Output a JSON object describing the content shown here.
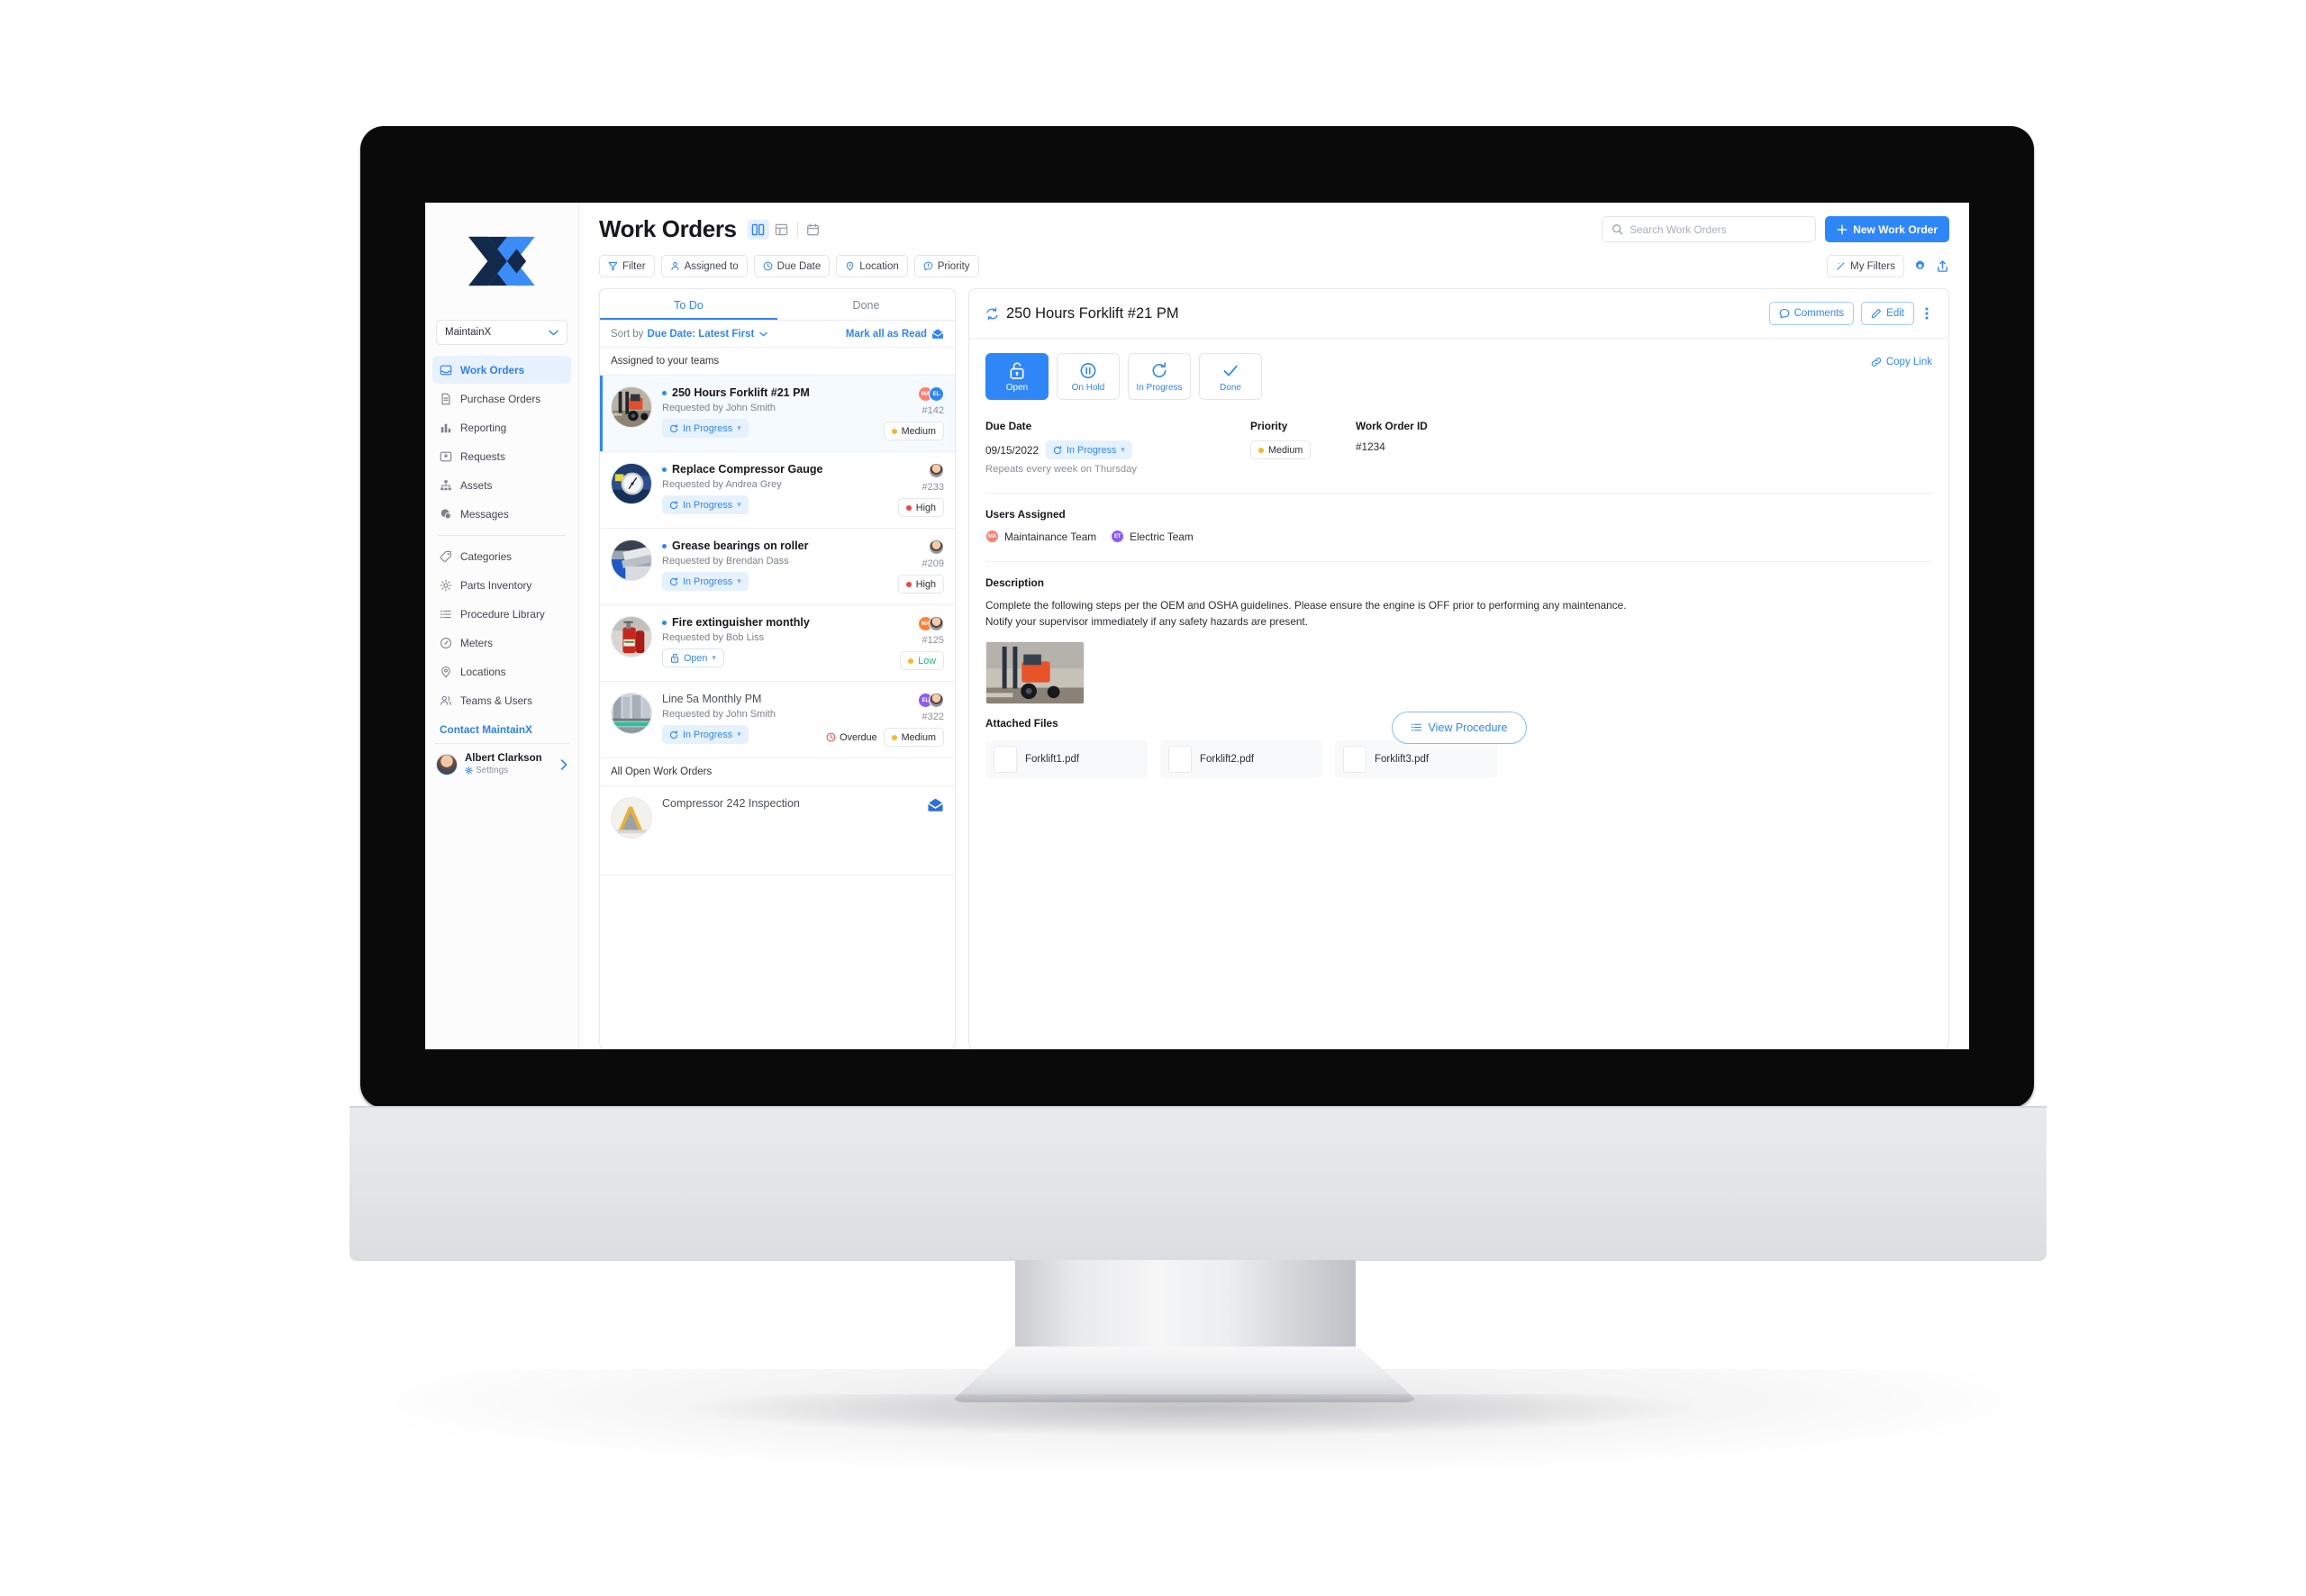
{
  "sidebar": {
    "logo_name": "maintainx-logo",
    "org": {
      "label": "MaintainX"
    },
    "items": [
      {
        "label": "Work Orders",
        "icon": "inbox-icon",
        "active": true
      },
      {
        "label": "Purchase Orders",
        "icon": "document-icon",
        "active": false
      },
      {
        "label": "Reporting",
        "icon": "bar-chart-icon",
        "active": false
      },
      {
        "label": "Requests",
        "icon": "inbox-down-icon",
        "active": false
      },
      {
        "label": "Assets",
        "icon": "hierarchy-icon",
        "active": false
      },
      {
        "label": "Messages",
        "icon": "chat-bubble-icon",
        "active": false
      }
    ],
    "items2": [
      {
        "label": "Categories",
        "icon": "tag-icon"
      },
      {
        "label": "Parts Inventory",
        "icon": "gear-icon"
      },
      {
        "label": "Procedure Library",
        "icon": "list-icon"
      },
      {
        "label": "Meters",
        "icon": "gauge-icon"
      },
      {
        "label": "Locations",
        "icon": "map-pin-icon"
      },
      {
        "label": "Teams & Users",
        "icon": "people-icon"
      }
    ],
    "contact": "Contact MaintainX",
    "user": {
      "name": "Albert Clarkson",
      "settings": "Settings"
    }
  },
  "header": {
    "title": "Work Orders",
    "views": [
      {
        "name": "split-view",
        "active": true
      },
      {
        "name": "table-view",
        "active": false
      },
      {
        "name": "calendar-view",
        "active": false
      }
    ],
    "search": {
      "placeholder": "Search Work Orders",
      "value": ""
    },
    "new_work_order": "New Work Order"
  },
  "filters": {
    "chips": [
      {
        "label": "Filter",
        "icon": "funnel-icon"
      },
      {
        "label": "Assigned to",
        "icon": "person-icon"
      },
      {
        "label": "Due Date",
        "icon": "clock-icon"
      },
      {
        "label": "Location",
        "icon": "map-pin-icon"
      },
      {
        "label": "Priority",
        "icon": "exclamation-bubble-icon"
      }
    ],
    "my_filters": "My Filters",
    "settings_icon": "gear-icon",
    "export_icon": "share-upload-icon"
  },
  "list": {
    "tabs": [
      {
        "label": "To Do",
        "active": true
      },
      {
        "label": "Done",
        "active": false
      }
    ],
    "sort_label": "Sort by",
    "sort_value": "Due Date: Latest First",
    "mark_all_read": "Mark all as Read",
    "group1": "Assigned to your teams",
    "group2": "All Open Work Orders",
    "items": [
      {
        "title": "250 Hours Forklift #21 PM",
        "requested_by": "Requested by John Smith",
        "status": "In Progress",
        "status_kind": "inprogress",
        "id": "#142",
        "priority": "Medium",
        "priority_color": "#f7b731",
        "priority_text_color": "#2a2d33",
        "unread": true,
        "selected": true,
        "overdue": "",
        "avatars": [
          {
            "initials": "MA",
            "color": "#fa8072"
          },
          {
            "initials": "EL",
            "color": "#2f86f6"
          }
        ],
        "thumb": "forklift"
      },
      {
        "title": "Replace Compressor Gauge",
        "requested_by": "Requested by Andrea Grey",
        "status": "In Progress",
        "status_kind": "inprogress",
        "id": "#233",
        "priority": "High",
        "priority_color": "#ef4444",
        "priority_text_color": "#2a2d33",
        "unread": true,
        "selected": false,
        "overdue": "",
        "avatars": [
          {
            "initials": "",
            "color": "photo"
          }
        ],
        "thumb": "gauge"
      },
      {
        "title": "Grease bearings on roller",
        "requested_by": "Requested by Brendan Dass",
        "status": "In Progress",
        "status_kind": "inprogress",
        "id": "#209",
        "priority": "High",
        "priority_color": "#ef4444",
        "priority_text_color": "#2a2d33",
        "unread": true,
        "selected": false,
        "overdue": "",
        "avatars": [
          {
            "initials": "",
            "color": "photo"
          }
        ],
        "thumb": "roller"
      },
      {
        "title": "Fire extinguisher monthly",
        "requested_by": "Requested by Bob Liss",
        "status": "Open",
        "status_kind": "open",
        "id": "#125",
        "priority": "Low",
        "priority_color": "#f7b731",
        "priority_text_color": "#22b573",
        "unread": true,
        "selected": false,
        "overdue": "",
        "avatars": [
          {
            "initials": "MA",
            "color": "#ff8038"
          },
          {
            "initials": "",
            "color": "photo"
          }
        ],
        "thumb": "extinguisher"
      },
      {
        "title": "Line 5a Monthly PM",
        "requested_by": "Requested by John Smith",
        "status": "In Progress",
        "status_kind": "inprogress",
        "id": "#322",
        "priority": "Medium",
        "priority_color": "#f7b731",
        "priority_text_color": "#2a2d33",
        "unread": false,
        "selected": false,
        "overdue": "Overdue",
        "avatars": [
          {
            "initials": "EL",
            "color": "#8b5cf6"
          },
          {
            "initials": "",
            "color": "photo"
          }
        ],
        "thumb": "line"
      },
      {
        "title": "Compressor 242 Inspection",
        "requested_by": "",
        "status": "",
        "status_kind": "",
        "id": "",
        "priority": "",
        "priority_color": "",
        "priority_text_color": "",
        "unread": false,
        "selected": false,
        "overdue": "",
        "avatars": [],
        "thumb": "compressor"
      }
    ]
  },
  "detail": {
    "title": "250 Hours Forklift #21 PM",
    "recurring_icon": "repeat-icon",
    "comments": "Comments",
    "edit": "Edit",
    "more_icon": "kebab-menu-icon",
    "status_buttons": [
      {
        "label": "Open",
        "icon": "unlock-icon",
        "active": true
      },
      {
        "label": "On Hold",
        "icon": "pause-icon",
        "active": false
      },
      {
        "label": "In Progress",
        "icon": "refresh-icon",
        "active": false
      },
      {
        "label": "Done",
        "icon": "check-icon",
        "active": false
      }
    ],
    "copy_link": "Copy Link",
    "due_date_label": "Due Date",
    "due_date_value": "09/15/2022",
    "due_status": "In Progress",
    "repeats": "Repeats every week on Thursday",
    "priority_label": "Priority",
    "priority_value": "Medium",
    "priority_color": "#f7b731",
    "work_order_id_label": "Work Order ID",
    "work_order_id_value": "#1234",
    "users_assigned_label": "Users Assigned",
    "teams": [
      {
        "name": "Maintainance Team",
        "initials": "MA",
        "color": "#fa8072"
      },
      {
        "name": "Electric Team",
        "initials": "ET",
        "color": "#8b5cf6"
      }
    ],
    "description_label": "Description",
    "description": "Complete the following steps per the OEM and OSHA guidelines. Please ensure the engine is OFF prior to performing any maintenance. Notify your supervisor immediately if any safety hazards are present.",
    "attached_files_label": "Attached Files",
    "view_procedure": "View Procedure",
    "files": [
      {
        "name": "Forklift1.pdf"
      },
      {
        "name": "Forklift2.pdf"
      },
      {
        "name": "Forklift3.pdf"
      }
    ]
  },
  "colors": {
    "accent": "#2f86f6",
    "accent_light": "#e6f1fe",
    "high": "#ef4444",
    "medium": "#f7b731",
    "low": "#22b573",
    "logo_dark": "#13294b",
    "logo_blue": "#3b8cf7"
  }
}
